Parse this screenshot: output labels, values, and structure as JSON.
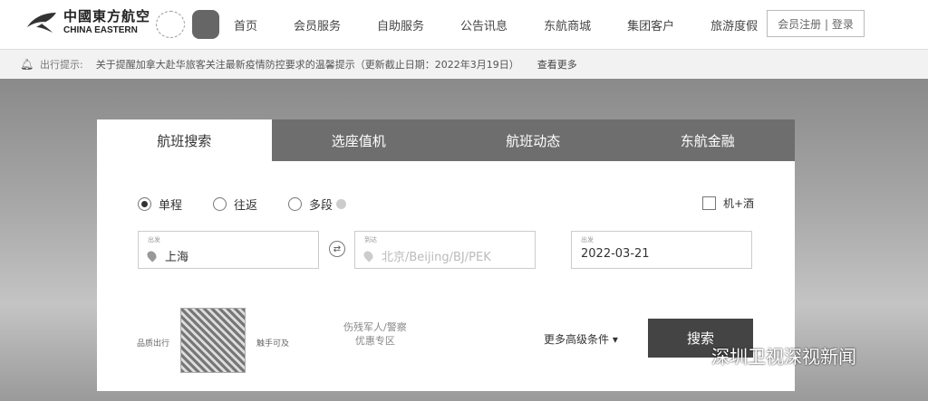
{
  "header": {
    "logo_cn": "中國東方航空",
    "logo_en": "CHINA EASTERN",
    "nav": [
      "首页",
      "会员服务",
      "自助服务",
      "公告讯息",
      "东航商城",
      "集团客户",
      "旅游度假"
    ],
    "login": "会员注册 | 登录"
  },
  "notice": {
    "label": "出行提示:",
    "message": "关于提醒加拿大赴华旅客关注最新疫情防控要求的温馨提示（更新截止日期：2022年3月19日）",
    "more": "查看更多"
  },
  "tabs": [
    "航班搜索",
    "选座值机",
    "航班动态",
    "东航金融"
  ],
  "trip_types": [
    "单程",
    "往返",
    "多段"
  ],
  "combo": "机+酒",
  "from": {
    "label": "出发",
    "value": "上海"
  },
  "to": {
    "label": "到达",
    "placeholder": "北京/Beijing/BJ/PEK"
  },
  "date": {
    "label": "出发",
    "value": "2022-03-21"
  },
  "qr": {
    "left": "品质出行",
    "right": "触手可及"
  },
  "promo": {
    "line1": "伤残军人/警察",
    "line2": "优惠专区"
  },
  "more_conditions": "更多高级条件 ▾",
  "search": "搜索",
  "watermark": "深圳卫视深视新闻"
}
